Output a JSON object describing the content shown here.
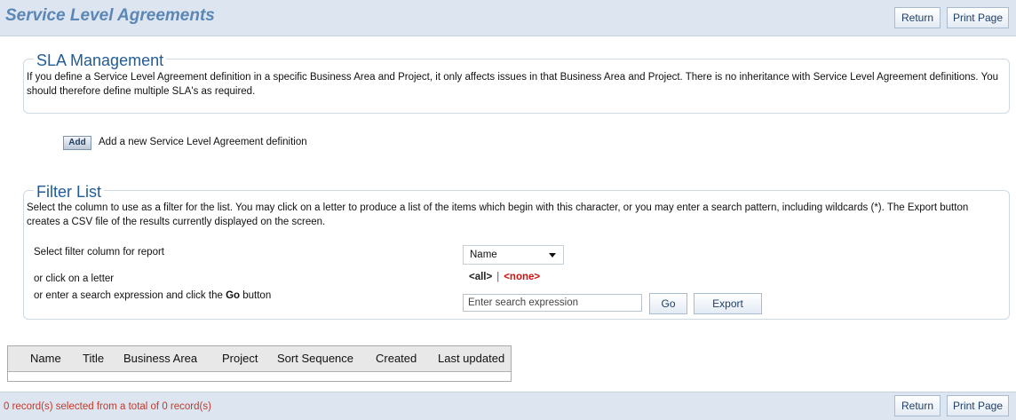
{
  "header": {
    "title": "Service Level Agreements",
    "return_label": "Return",
    "print_label": "Print Page"
  },
  "sla": {
    "legend": "SLA Management",
    "description": "If you define a Service Level Agreement definition in a specific Business Area and Project, it only affects issues in that Business Area and Project. There is no inheritance with Service Level Agreement definitions. You should therefore define multiple SLA's as required."
  },
  "add": {
    "button_label": "Add",
    "text": "Add a new Service Level Agreement definition"
  },
  "filter": {
    "legend": "Filter List",
    "description": "Select the column to use as a filter for the list. You may click on a letter to produce a list of the items which begin with this character, or you may enter a search pattern, including wildcards (*). The Export button creates a CSV file of the results currently displayed on the screen.",
    "column_label": "Select filter column for report",
    "column_value": "Name",
    "letter_label": "or click on a letter",
    "letter_all": "<all>",
    "letter_separator": "|",
    "letter_none": "<none>",
    "search_label_prefix": "or enter a search expression and click the ",
    "search_label_go": "Go",
    "search_label_suffix": " button",
    "search_placeholder": "Enter search expression",
    "go_label": "Go",
    "export_label": "Export"
  },
  "grid": {
    "columns": [
      "Name",
      "Title",
      "Business Area",
      "Project",
      "Sort Sequence",
      "Created",
      "Last updated"
    ]
  },
  "footer": {
    "status": "0 record(s) selected from a total of 0 record(s)",
    "return_label": "Return",
    "print_label": "Print Page"
  },
  "colors": {
    "title": "#5b86b5",
    "legend": "#1f5c99",
    "bar_background": "#dde6f0",
    "status_text": "#c0392b",
    "none_letter": "#cc1111"
  }
}
